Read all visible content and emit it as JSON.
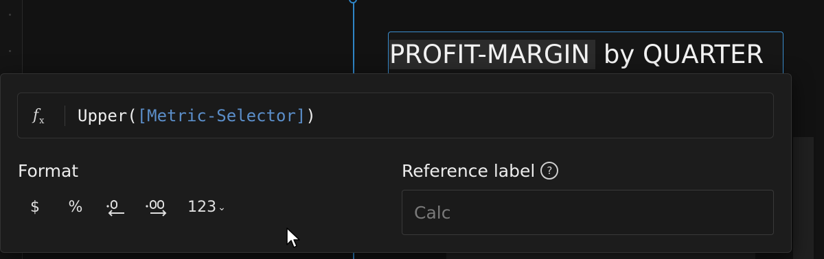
{
  "canvas": {
    "title_highlight": "PROFIT-MARGIN",
    "title_rest": " by QUARTER"
  },
  "formula": {
    "fx_label": "f",
    "fx_sub": "x",
    "prefix": "Upper(",
    "reference": "[Metric-Selector]",
    "suffix": ")"
  },
  "format": {
    "label": "Format",
    "buttons": {
      "currency": "$",
      "percent": "%",
      "number": "123"
    }
  },
  "reference": {
    "label": "Reference label",
    "help": "?",
    "placeholder": "Calc"
  },
  "colors": {
    "accent": "#2f86c8",
    "reference_token": "#5b8ec9",
    "panel_bg": "#1c1c1c"
  },
  "icons": {
    "function": "fx-icon",
    "decrease_decimal": "decrease-decimal-icon",
    "increase_decimal": "increase-decimal-icon",
    "dropdown": "chevron-down-icon",
    "help": "help-circle-icon"
  }
}
